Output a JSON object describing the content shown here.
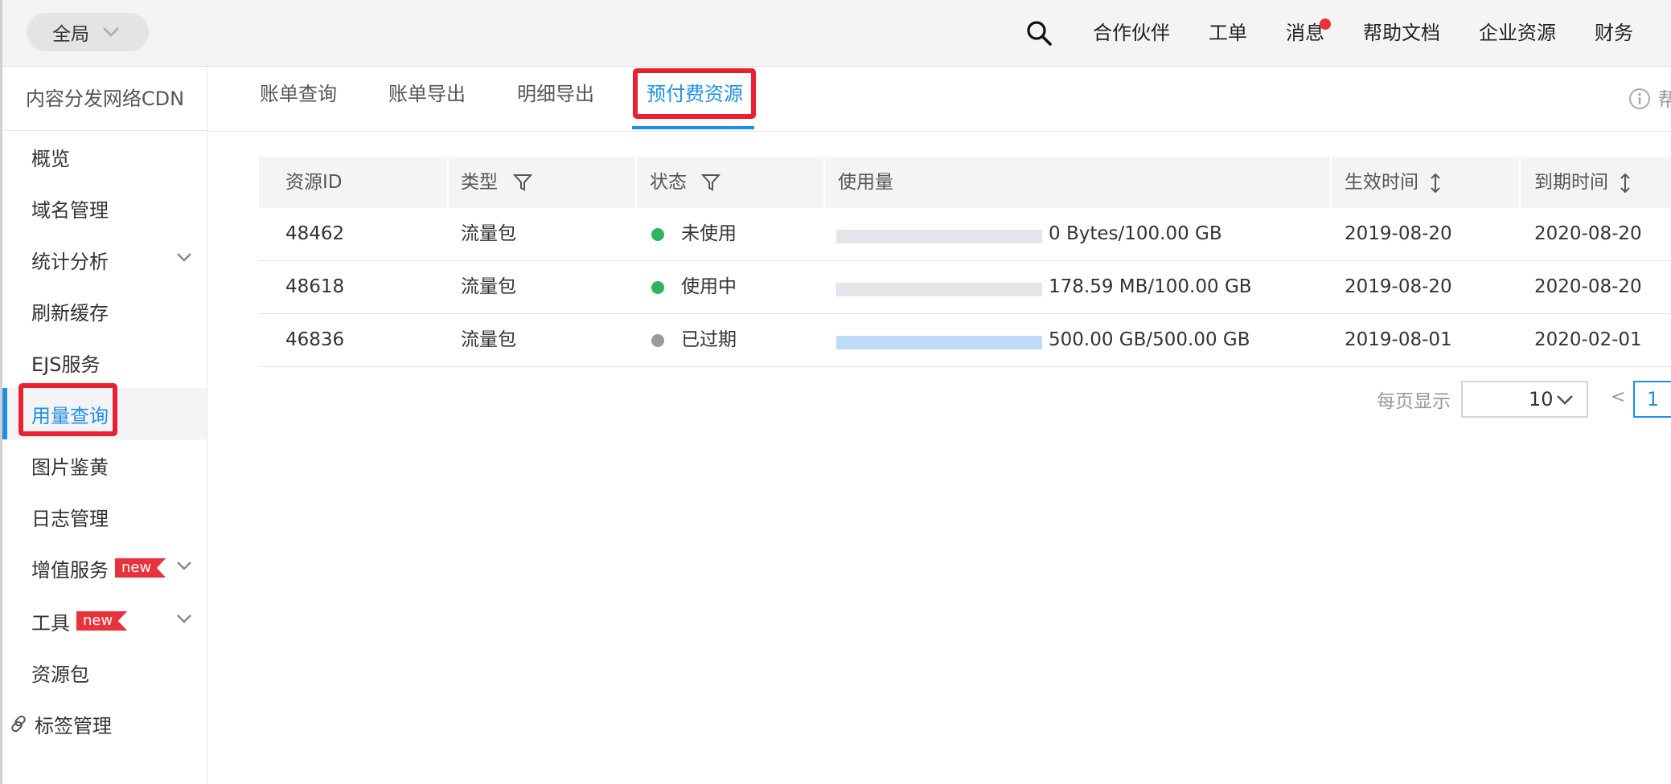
{
  "topbar": {
    "scope_label": "全局",
    "nav": [
      "合作伙伴",
      "工单",
      "消息",
      "帮助文档",
      "企业资源",
      "财务"
    ]
  },
  "sidebar": {
    "title": "内容分发网络CDN",
    "items": [
      {
        "label": "概览"
      },
      {
        "label": "域名管理"
      },
      {
        "label": "统计分析"
      },
      {
        "label": "刷新缓存"
      },
      {
        "label": "EJS服务"
      },
      {
        "label": "用量查询"
      },
      {
        "label": "图片鉴黄"
      },
      {
        "label": "日志管理"
      },
      {
        "label": "增值服务",
        "badge": "new"
      },
      {
        "label": "工具",
        "badge": "new"
      },
      {
        "label": "资源包"
      },
      {
        "label": "标签管理"
      }
    ]
  },
  "tabs": [
    "账单查询",
    "账单导出",
    "明细导出",
    "预付费资源"
  ],
  "help_text": "帮",
  "table": {
    "headers": [
      "资源ID",
      "类型",
      "状态",
      "使用量",
      "生效时间",
      "到期时间"
    ],
    "rows": [
      {
        "id": "48462",
        "type": "流量包",
        "status": "未使用",
        "status_color": "#2db55d",
        "usage": "0 Bytes/100.00 GB",
        "usage_fraction": 0,
        "start": "2019-08-20",
        "end": "2020-08-20"
      },
      {
        "id": "48618",
        "type": "流量包",
        "status": "使用中",
        "status_color": "#2db55d",
        "usage": "178.59 MB/100.00 GB",
        "usage_fraction": 0.0017,
        "start": "2019-08-20",
        "end": "2020-08-20"
      },
      {
        "id": "46836",
        "type": "流量包",
        "status": "已过期",
        "status_color": "#9b9b9b",
        "usage": "500.00 GB/500.00 GB",
        "usage_fraction": 1.0,
        "start": "2019-08-01",
        "end": "2020-02-01"
      }
    ]
  },
  "pagination": {
    "per_page_label": "每页显示",
    "per_page": "10",
    "prev": "<",
    "current_page": "1"
  },
  "colors": {
    "accent": "#1f8fe5",
    "highlight": "#e8202f"
  }
}
